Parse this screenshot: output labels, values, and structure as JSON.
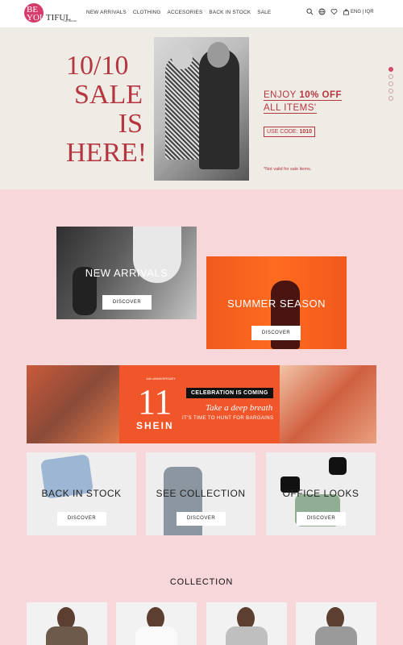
{
  "header": {
    "logo_top": "BE",
    "logo_bottom": "YOU",
    "logo_tail": "TIFUL",
    "logo_sub": "THE BRAND",
    "nav": [
      "NEW ARRIVALS",
      "CLOTHING",
      "ACCESORIES",
      "BACK IN STOCK",
      "SALE"
    ],
    "icons": [
      "search-icon",
      "globe-icon",
      "heart-icon",
      "bag-icon"
    ],
    "lang": "ENG | IQR"
  },
  "hero": {
    "title_lines": [
      "10/10",
      "SALE",
      "IS",
      "HERE!"
    ],
    "offer_line1_pre": "ENJOY ",
    "offer_line1_bold": "10% OFF",
    "offer_line2": "ALL ITEMS'",
    "code_label": "USE CODE: ",
    "code_value": "1010",
    "note": "*Not valid for sale items.",
    "slides": 5,
    "active_slide": 1
  },
  "tiles": {
    "new_arrivals": {
      "title": "NEW ARRIVALS",
      "button": "DISCOVER"
    },
    "summer": {
      "title": "SUMMER SEASON",
      "button": "DISCOVER"
    },
    "back_in_stock": {
      "title": "BACK IN STOCK",
      "button": "DISCOVER"
    },
    "see_collection": {
      "title": "SEE COLLECTION",
      "button": "DISCOVER"
    },
    "office_looks": {
      "title": "OFFICE LOOKS",
      "button": "DISCOVER"
    }
  },
  "banner": {
    "anniv": "11th ANNIVERSARY",
    "number": "11",
    "brand": "SHEIN",
    "pill": "CELEBRATION IS COMING",
    "tagline": "Take a deep breath",
    "subline": "IT'S TIME TO HUNT FOR BARGAINS"
  },
  "collection": {
    "title": "COLLECTION"
  },
  "colors": {
    "accent": "#b53640",
    "page_bg": "#f8d7db",
    "hero_bg": "#efece5",
    "summer_bg": "#ff6b1f"
  }
}
